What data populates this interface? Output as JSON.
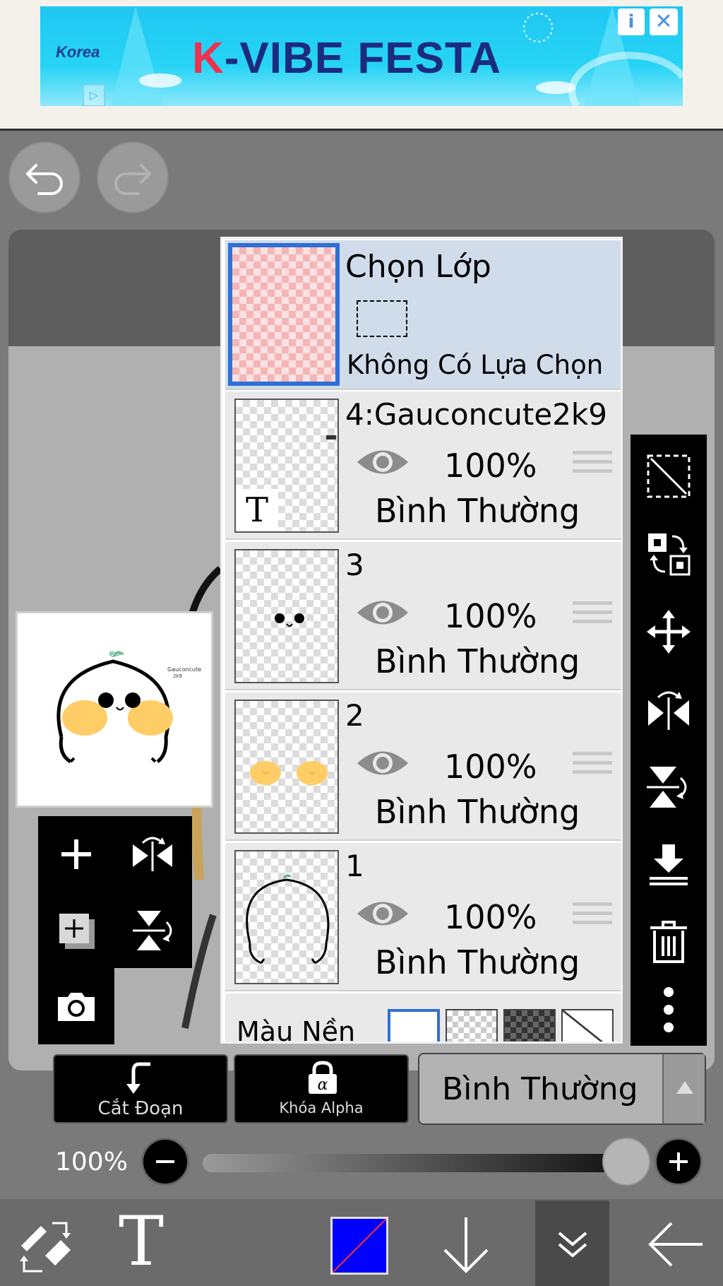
{
  "ad": {
    "title_k": "K",
    "title_rest": "-VIBE FESTA",
    "logo": "Korea",
    "info_icon": "i",
    "close_icon": "✕"
  },
  "toolbar": {
    "undo_icon": "undo-icon",
    "redo_icon": "redo-icon"
  },
  "selection_layer": {
    "title": "Chọn Lớp",
    "status": "Không Có Lựa Chọn"
  },
  "layers": [
    {
      "name": "4:Gauconcute2k9",
      "opacity": "100%",
      "blend": "Bình Thường"
    },
    {
      "name": "3",
      "opacity": "100%",
      "blend": "Bình Thường"
    },
    {
      "name": "2",
      "opacity": "100%",
      "blend": "Bình Thường"
    },
    {
      "name": "1",
      "opacity": "100%",
      "blend": "Bình Thường"
    }
  ],
  "background_color_label": "Màu Nền",
  "bottom_controls": {
    "clip_label": "Cắt Đoạn",
    "alpha_lock_label": "Khóa Alpha",
    "blend_mode": "Bình Thường",
    "opacity": "100%",
    "opacity_value": 1.0
  },
  "bottom_bar": {
    "text_tool": "T",
    "color": "#0000ff"
  },
  "colors": {
    "selected_border": "#2f6fd6",
    "panel_bg": "#e9e9e9",
    "selection_bg": "#d0dcea"
  }
}
